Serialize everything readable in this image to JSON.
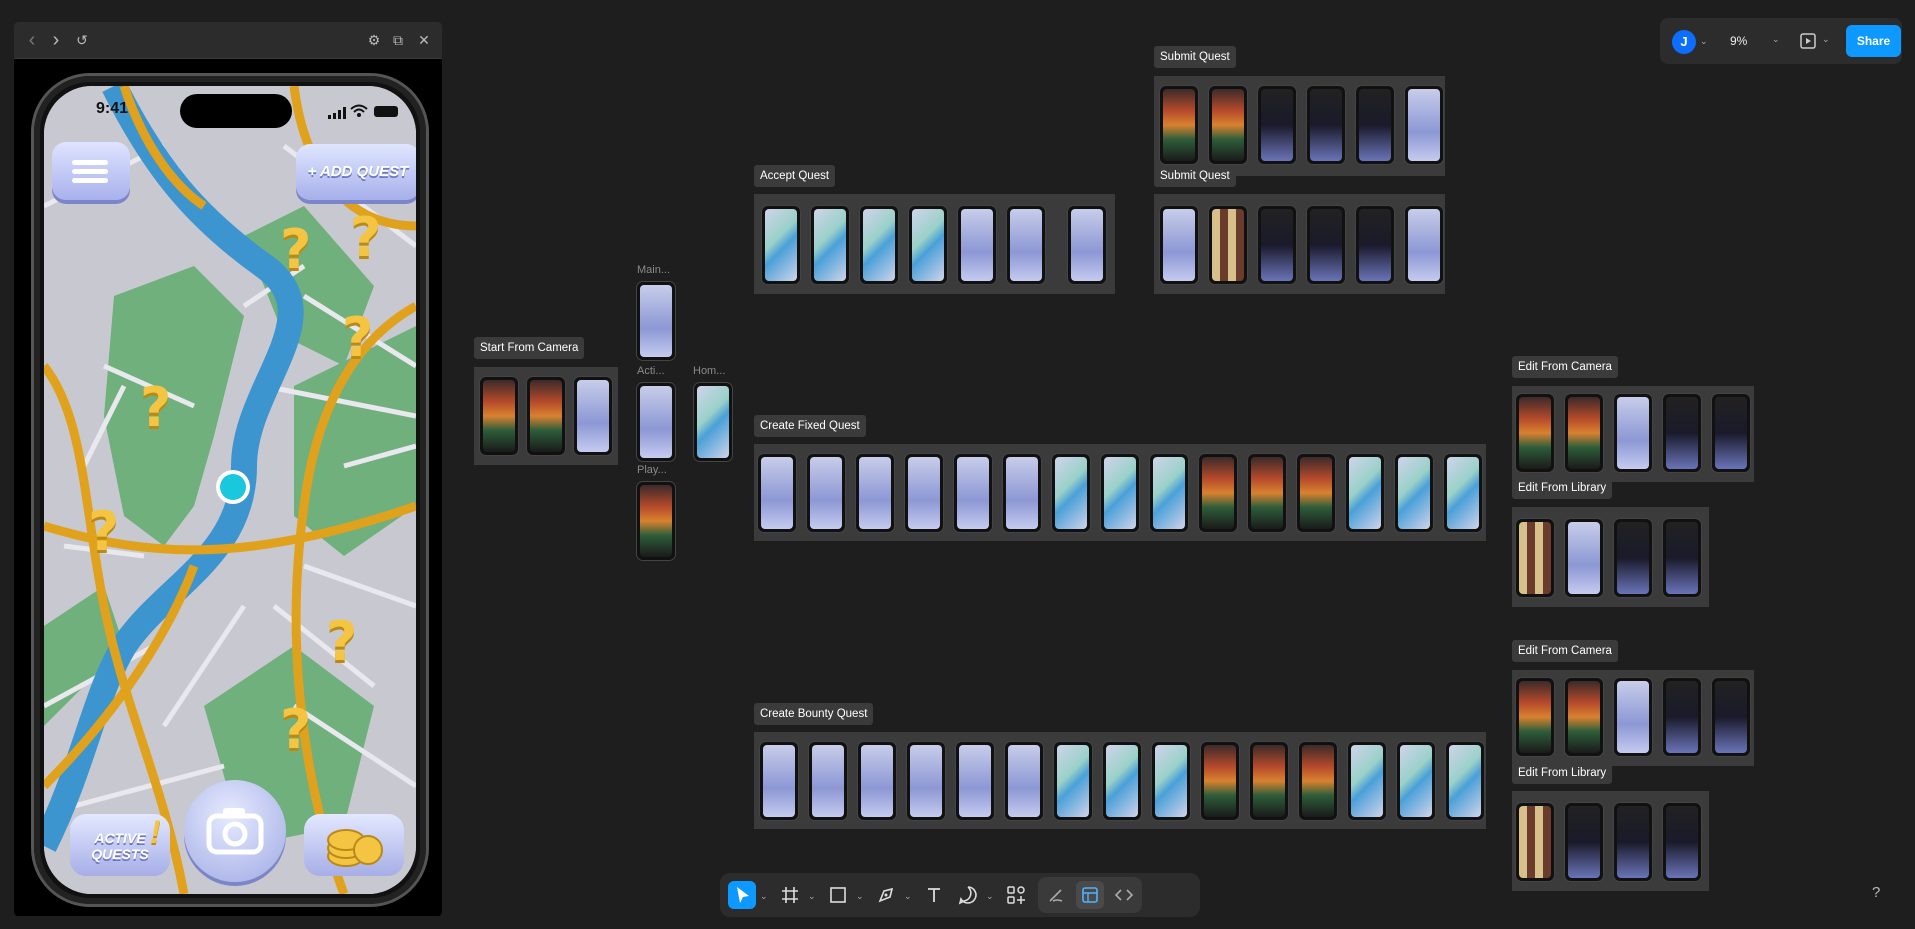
{
  "preview": {
    "toolbar": {
      "back": "‹",
      "forward": "›",
      "restart": "↺",
      "settings": "⚙",
      "open": "⧉",
      "close": "✕"
    },
    "status_time": "9:41",
    "add_quest_label": "+ ADD QUEST",
    "active_quests_line1": "ACTIVE",
    "active_quests_line2": "QUESTS",
    "active_quests_mark": "!",
    "qmark": "?"
  },
  "topbar": {
    "avatar_initial": "J",
    "zoom": "9%",
    "share_label": "Share"
  },
  "sections": {
    "start_from_camera": "Start From Camera",
    "main": "Main...",
    "active": "Acti...",
    "home": "Hom...",
    "play": "Play...",
    "accept_quest": "Accept Quest",
    "submit_quest_1": "Submit Quest",
    "submit_quest_2": "Submit Quest",
    "create_fixed_quest": "Create Fixed Quest",
    "create_bounty_quest": "Create Bounty Quest",
    "edit_from_camera_1": "Edit From Camera",
    "edit_from_library_1": "Edit From Library",
    "edit_from_camera_2": "Edit From Camera",
    "edit_from_library_2": "Edit From Library"
  },
  "help": "?",
  "icons": {
    "toolbar": [
      "move-tool-icon",
      "frame-tool-icon",
      "rectangle-tool-icon",
      "pen-tool-icon",
      "text-tool-icon",
      "comment-tool-icon",
      "actions-icon",
      "draw-icon",
      "design-mode-icon",
      "dev-mode-icon"
    ]
  },
  "colors": {
    "canvas": "#1e1e1e",
    "accent": "#0d99ff",
    "coin": "#f4c542",
    "location": "#1ac8de"
  }
}
